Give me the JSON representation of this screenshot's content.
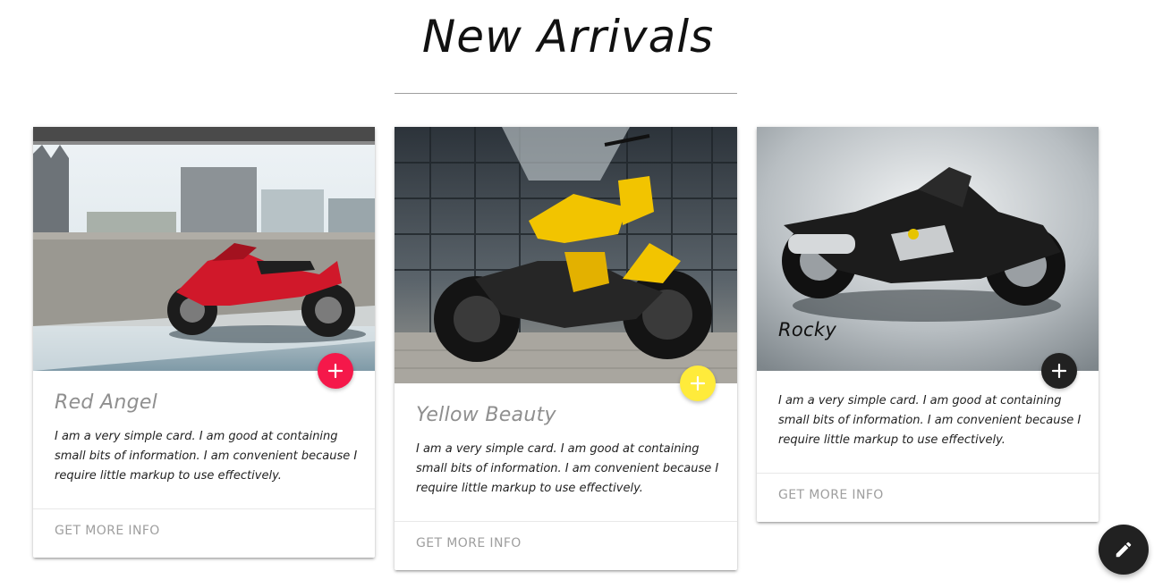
{
  "page": {
    "title": "New Arrivals"
  },
  "colors": {
    "red_fab": "#f5184a",
    "yellow_fab": "#ffeb3b",
    "dark_fab": "#212121",
    "muted_text": "#9e9e9e"
  },
  "cards": [
    {
      "title": "Red Angel",
      "text": "I am a very simple card. I am good at containing small bits of information. I am convenient because I require little markup to use effectively.",
      "action": "GET MORE INFO",
      "fab_icon": "plus-icon",
      "image": "red sport motorcycle parked on rooftop"
    },
    {
      "title": "Yellow Beauty",
      "text": "I am a very simple card. I am good at containing small bits of information. I am convenient because I require little markup to use effectively.",
      "action": "GET MORE INFO",
      "fab_icon": "plus-icon",
      "image": "yellow naked motorcycle in glass building courtyard"
    },
    {
      "title": "Rocky",
      "text": "I am a very simple card. I am good at containing small bits of information. I am convenient because I require little markup to use effectively.",
      "action": "GET MORE INFO",
      "fab_icon": "plus-icon",
      "image": "black chrome concept motorcycle on grey backdrop"
    }
  ],
  "floating_action": {
    "icon": "pencil-icon"
  }
}
